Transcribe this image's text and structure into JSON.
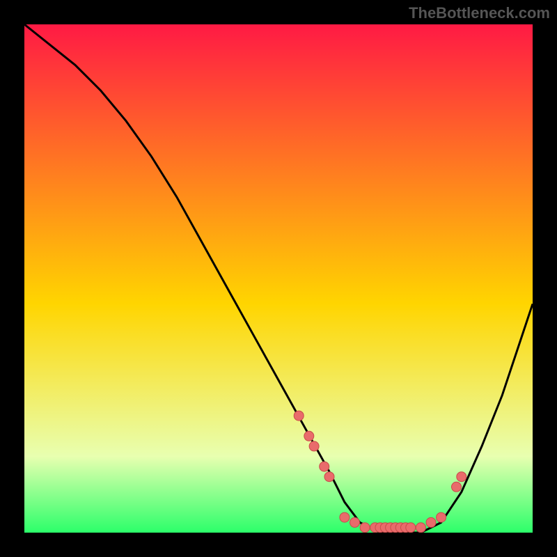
{
  "watermark": "TheBottleneck.com",
  "colors": {
    "bg": "#000000",
    "gradient_top": "#ff1a44",
    "gradient_mid": "#ffd500",
    "gradient_low": "#e8ffb0",
    "gradient_bottom": "#2cff6a",
    "curve": "#000000",
    "point_fill": "#e96b6b",
    "point_stroke": "#c94a4a"
  },
  "chart_data": {
    "type": "line",
    "title": "",
    "xlabel": "",
    "ylabel": "",
    "xlim": [
      0,
      100
    ],
    "ylim": [
      0,
      100
    ],
    "curve": {
      "x": [
        0,
        5,
        10,
        15,
        20,
        25,
        30,
        35,
        40,
        45,
        50,
        55,
        60,
        63,
        66,
        70,
        74,
        78,
        82,
        86,
        90,
        94,
        100
      ],
      "y": [
        100,
        96,
        92,
        87,
        81,
        74,
        66,
        57,
        48,
        39,
        30,
        21,
        12,
        6,
        2,
        0,
        0,
        0,
        2,
        8,
        17,
        27,
        45
      ]
    },
    "points": [
      {
        "x": 54,
        "y": 23
      },
      {
        "x": 56,
        "y": 19
      },
      {
        "x": 57,
        "y": 17
      },
      {
        "x": 59,
        "y": 13
      },
      {
        "x": 60,
        "y": 11
      },
      {
        "x": 63,
        "y": 3
      },
      {
        "x": 65,
        "y": 2
      },
      {
        "x": 67,
        "y": 1
      },
      {
        "x": 69,
        "y": 1
      },
      {
        "x": 70,
        "y": 1
      },
      {
        "x": 71,
        "y": 1
      },
      {
        "x": 72,
        "y": 1
      },
      {
        "x": 73,
        "y": 1
      },
      {
        "x": 74,
        "y": 1
      },
      {
        "x": 75,
        "y": 1
      },
      {
        "x": 76,
        "y": 1
      },
      {
        "x": 78,
        "y": 1
      },
      {
        "x": 80,
        "y": 2
      },
      {
        "x": 82,
        "y": 3
      },
      {
        "x": 85,
        "y": 9
      },
      {
        "x": 86,
        "y": 11
      }
    ]
  }
}
